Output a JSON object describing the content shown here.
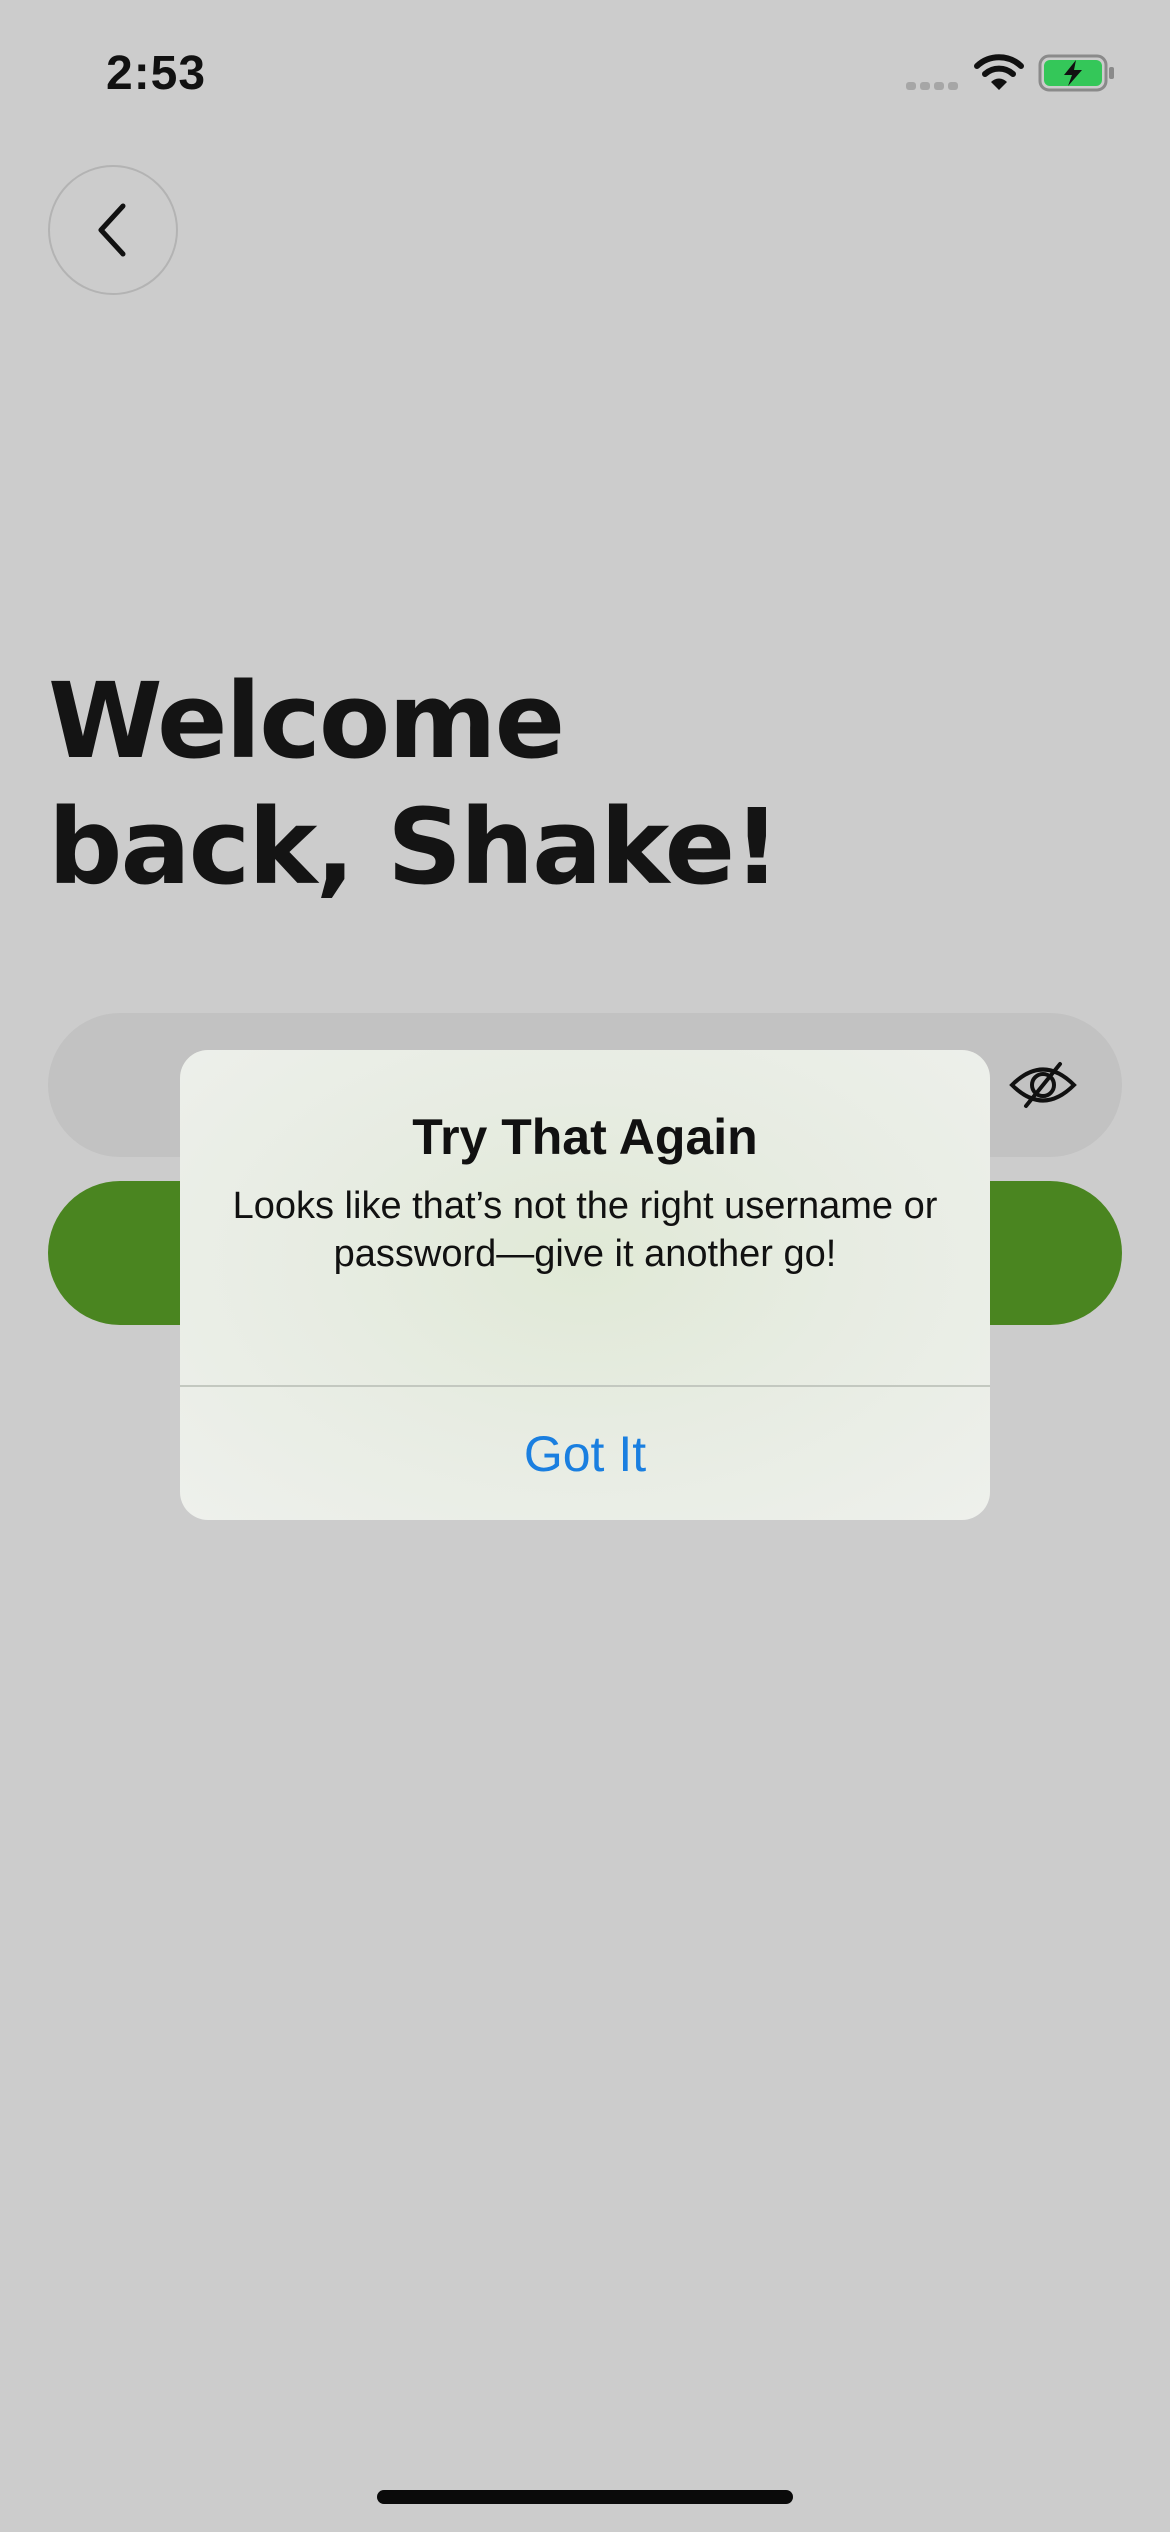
{
  "status_bar": {
    "time": "2:53",
    "icons": [
      "cellular-signal-icon",
      "wifi-icon",
      "battery-charging-icon"
    ],
    "battery_color": "#34c759"
  },
  "nav": {
    "back_icon": "chevron-left-icon"
  },
  "welcome": {
    "line1": "Welcome",
    "line2": "back, Shake!"
  },
  "password_field": {
    "value": "",
    "visibility_icon": "eye-slash-icon"
  },
  "login_button": {
    "label": "",
    "color": "#4a8520"
  },
  "alert": {
    "title": "Try That Again",
    "message": "Looks like that’s not the right username or password—give it another go!",
    "button_label": "Got It",
    "button_color": "#1a7fe0"
  }
}
